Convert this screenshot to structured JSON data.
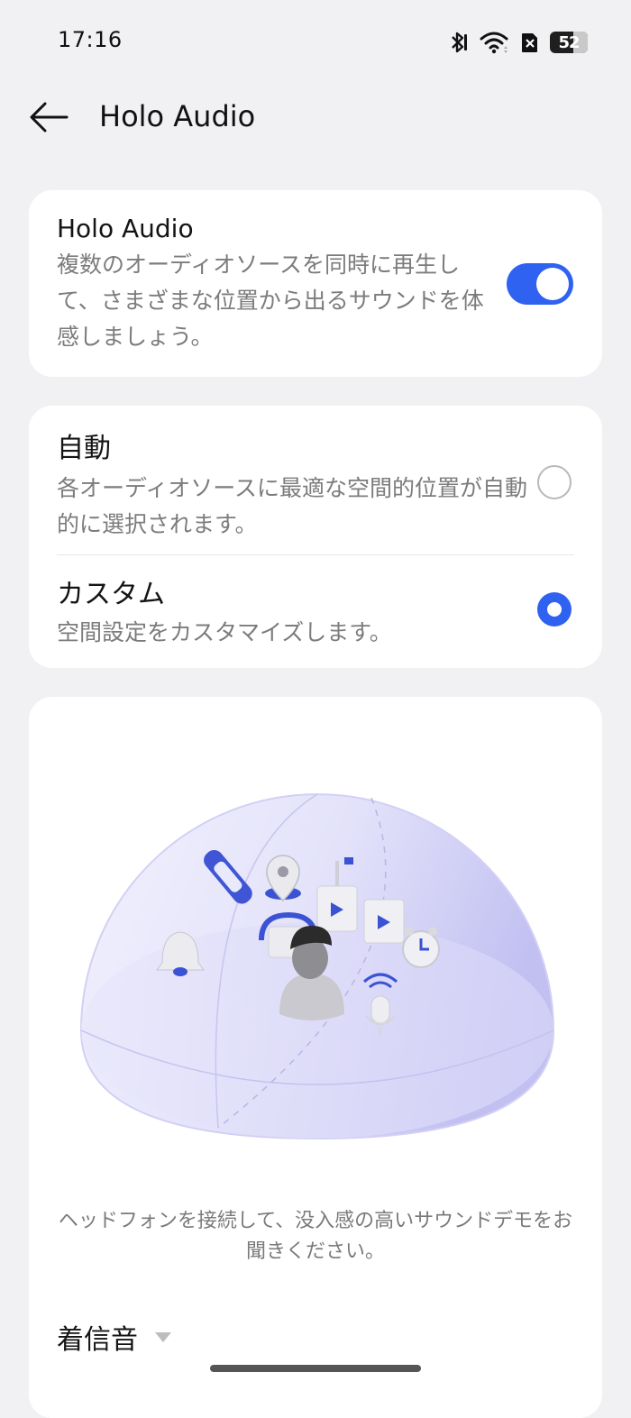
{
  "status_bar": {
    "time": "17:16",
    "battery_level": "52",
    "icons": [
      "bluetooth-icon",
      "wifi-icon",
      "sim-off-icon",
      "battery-icon"
    ]
  },
  "header": {
    "title": "Holo Audio",
    "back_icon": "arrow-left-icon"
  },
  "holo_audio": {
    "title": "Holo Audio",
    "description": "複数のオーディオソースを同時に再生して、さまざまな位置から出るサウンドを体感しましょう。",
    "enabled": true
  },
  "mode_options": [
    {
      "title": "自動",
      "description": "各オーディオソースに最適な空間的位置が自動的に選択されます。",
      "selected": false
    },
    {
      "title": "カスタム",
      "description": "空間設定をカスタマイズします。",
      "selected": true
    }
  ],
  "demo": {
    "hint": "ヘッドフォンを接続して、没入感の高いサウンドデモをお聞きください。",
    "ringtone_label": "着信音"
  },
  "colors": {
    "accent": "#2f62f0",
    "background": "#f1f1f3",
    "card": "#ffffff",
    "dome": "#c7c5f2"
  }
}
